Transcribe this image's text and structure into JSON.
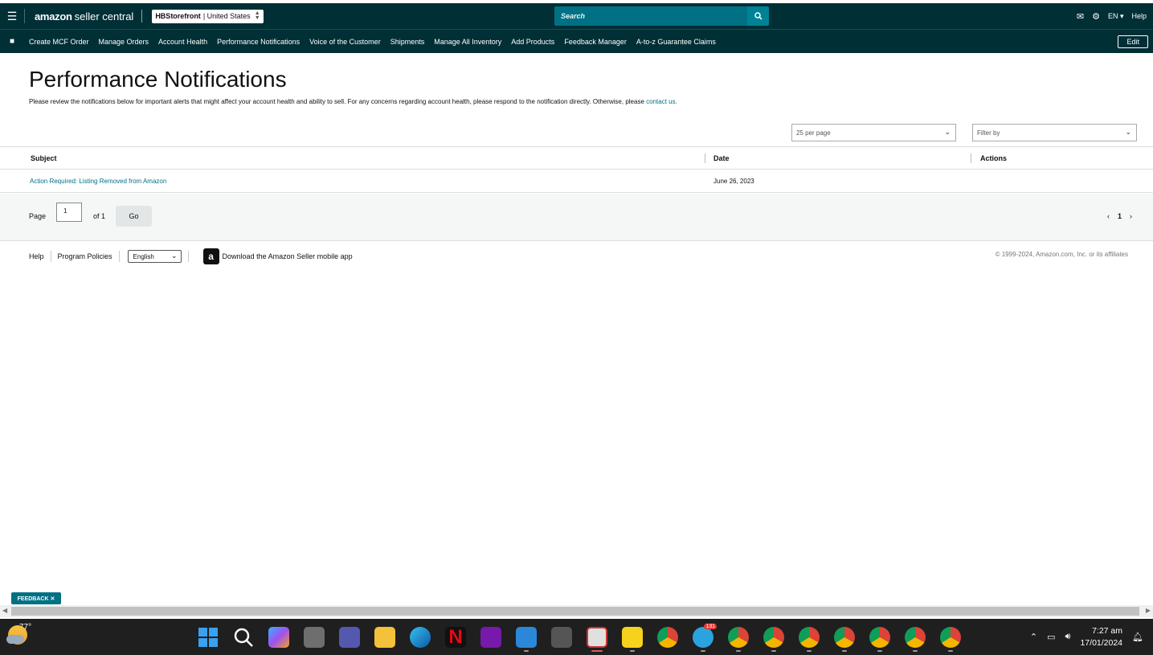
{
  "header": {
    "logo_main": "amazon",
    "logo_sub": "seller central",
    "store_name": "HBStorefront",
    "store_region": "| United States",
    "search_placeholder": "Search",
    "language": "EN",
    "help": "Help"
  },
  "nav": {
    "items": [
      "Create MCF Order",
      "Manage Orders",
      "Account Health",
      "Performance Notifications",
      "Voice of the Customer",
      "Shipments",
      "Manage All Inventory",
      "Add Products",
      "Feedback Manager",
      "A-to-z Guarantee Claims"
    ],
    "edit_label": "Edit"
  },
  "page": {
    "title": "Performance Notifications",
    "description": "Please review the notifications below for important alerts that might affect your account health and ability to sell. For any concerns regarding account health, please respond to the notification directly. Otherwise, please",
    "contact_link": "contact us.",
    "per_page": "25 per page",
    "filter_placeholder": "Filter by"
  },
  "table": {
    "headers": {
      "subject": "Subject",
      "date": "Date",
      "actions": "Actions"
    },
    "rows": [
      {
        "subject": "Action Required: Listing Removed from Amazon",
        "date": "June 26, 2023",
        "actions": ""
      }
    ]
  },
  "pager": {
    "page_label": "Page",
    "page_value": "1",
    "of_label": "of 1",
    "go_label": "Go",
    "current_page": "1"
  },
  "footer": {
    "help": "Help",
    "policies": "Program Policies",
    "language": "English",
    "app_text": "Download the Amazon Seller mobile app",
    "copyright": "© 1999-2024, Amazon.com, Inc. or its affiliates"
  },
  "feedback": {
    "label": "FEEDBACK ✕"
  },
  "taskbar": {
    "weather_temp": "77°",
    "time": "7:27 am",
    "date": "17/01/2024",
    "telegram_badge": "131"
  },
  "colors": {
    "header_bg": "#002f36",
    "search_bg": "#007185",
    "link": "#007185"
  }
}
